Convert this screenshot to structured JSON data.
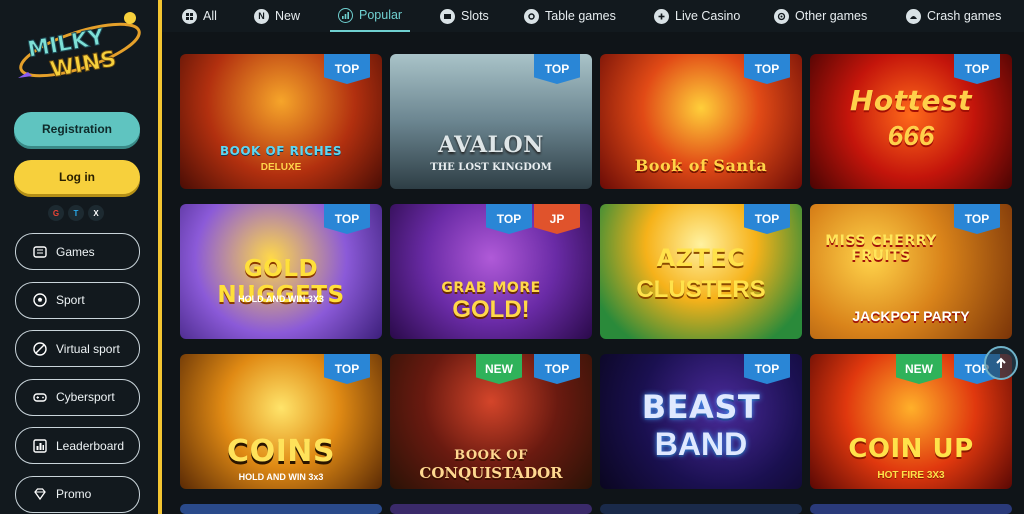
{
  "brand": {
    "logo_line1": "MILKY",
    "logo_line2": "WINS"
  },
  "auth": {
    "register_label": "Registration",
    "login_label": "Log in"
  },
  "social": [
    "G",
    "T",
    "X"
  ],
  "sidebar": {
    "items": [
      {
        "label": "Games",
        "icon": "games-icon"
      },
      {
        "label": "Sport",
        "icon": "soccer-ball-icon"
      },
      {
        "label": "Virtual sport",
        "icon": "virtual-sport-icon"
      },
      {
        "label": "Cybersport",
        "icon": "gamepad-icon"
      },
      {
        "label": "Leaderboard",
        "icon": "leaderboard-icon"
      },
      {
        "label": "Promo",
        "icon": "diamond-icon"
      }
    ]
  },
  "tabs": [
    {
      "label": "All",
      "icon": "grid-icon"
    },
    {
      "label": "New",
      "icon": "new-icon"
    },
    {
      "label": "Popular",
      "icon": "popular-icon",
      "active": true
    },
    {
      "label": "Slots",
      "icon": "slots-icon"
    },
    {
      "label": "Table games",
      "icon": "table-games-icon"
    },
    {
      "label": "Live Casino",
      "icon": "live-casino-icon"
    },
    {
      "label": "Other games",
      "icon": "other-games-icon"
    },
    {
      "label": "Crash games",
      "icon": "crash-games-icon"
    }
  ],
  "games": [
    {
      "title": "BOOK OF RICHES",
      "subtitle": "DELUXE",
      "badges": [
        "TOP"
      ]
    },
    {
      "title": "AVALON",
      "subtitle": "THE LOST KINGDOM",
      "badges": [
        "TOP"
      ]
    },
    {
      "title": "Book of Santa",
      "subtitle": "",
      "badges": [
        "TOP"
      ]
    },
    {
      "title": "Hottest",
      "subtitle": "666",
      "badges": [
        "TOP"
      ]
    },
    {
      "title": "GOLD NUGGETS",
      "subtitle": "HOLD AND WIN 3X3",
      "badges": [
        "TOP"
      ]
    },
    {
      "title": "GRAB MORE",
      "subtitle": "GOLD!",
      "badges": [
        "TOP",
        "JP"
      ]
    },
    {
      "title": "AZTEC",
      "subtitle": "CLUSTERS",
      "badges": [
        "TOP"
      ]
    },
    {
      "title": "MISS CHERRY FRUITS",
      "subtitle": "JACKPOT PARTY",
      "badges": [
        "TOP"
      ]
    },
    {
      "title": "COINS",
      "subtitle": "HOLD AND WIN 3x3",
      "badges": [
        "TOP"
      ]
    },
    {
      "title": "BOOK OF",
      "subtitle": "CONQUISTADOR",
      "badges": [
        "NEW",
        "TOP"
      ]
    },
    {
      "title": "BEAST",
      "subtitle": "BAND",
      "badges": [
        "TOP"
      ]
    },
    {
      "title": "COIN UP",
      "subtitle": "HOT FIRE 3X3",
      "badges": [
        "NEW",
        "TOP"
      ]
    }
  ],
  "colors": {
    "accent": "#f4c531",
    "teal": "#5fc4c0",
    "top_badge": "#2a86d6",
    "new_badge": "#2fb25a",
    "jp_badge": "#e0532c"
  }
}
